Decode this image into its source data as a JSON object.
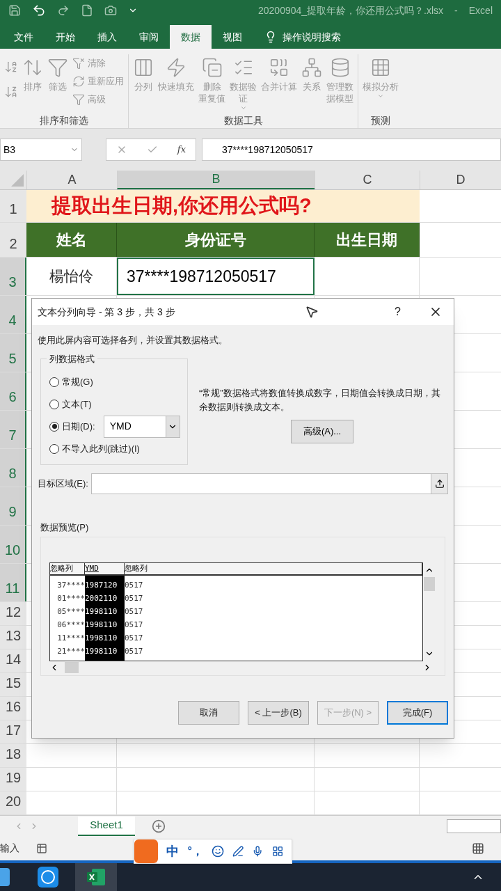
{
  "title_bar": {
    "file_name": "20200904_提取年龄，你还用公式吗？.xlsx",
    "separator": "-",
    "app": "Excel"
  },
  "ribbon_tabs": [
    {
      "label": "文件",
      "selected": false
    },
    {
      "label": "开始",
      "selected": false
    },
    {
      "label": "插入",
      "selected": false
    },
    {
      "label": "审阅",
      "selected": false
    },
    {
      "label": "数据",
      "selected": true
    },
    {
      "label": "视图",
      "selected": false
    }
  ],
  "tell_me": "操作说明搜索",
  "ribbon_groups": [
    {
      "label": "排序和筛选",
      "items": [
        {
          "kind": "icon"
        },
        {
          "kind": "icon"
        },
        {
          "kind": "large",
          "label": "排序"
        },
        {
          "kind": "large",
          "label": "筛选"
        },
        {
          "kind": "small",
          "label": "清除"
        },
        {
          "kind": "small",
          "label": "重新应用"
        },
        {
          "kind": "small",
          "label": "高级"
        }
      ]
    },
    {
      "label": "数据工具",
      "items": [
        {
          "kind": "large",
          "label": "分列",
          "dropdown": false
        },
        {
          "kind": "large",
          "label": "快速填充",
          "dropdown": false
        },
        {
          "kind": "large",
          "lines": [
            "删除",
            "重复值"
          ],
          "dropdown": false
        },
        {
          "kind": "large",
          "lines": [
            "数据验",
            "证"
          ],
          "dropdown": true
        },
        {
          "kind": "large",
          "label": "合并计算",
          "dropdown": false
        },
        {
          "kind": "large",
          "label": "关系",
          "dropdown": false
        },
        {
          "kind": "large",
          "lines": [
            "管理数",
            "据模型"
          ],
          "dropdown": false
        }
      ]
    },
    {
      "label": "预测",
      "items": [
        {
          "kind": "large",
          "label": "模拟分析",
          "dropdown": true
        }
      ]
    }
  ],
  "formula_bar": {
    "name_box": "B3",
    "fx": "fx",
    "value": "37****198712050517"
  },
  "columns": [
    {
      "label": "A",
      "selected": false
    },
    {
      "label": "B",
      "selected": true
    },
    {
      "label": "C",
      "selected": false
    },
    {
      "label": "D",
      "selected": false
    }
  ],
  "rows": [
    {
      "number": "1",
      "selected": false
    },
    {
      "number": "2",
      "selected": false
    },
    {
      "number": "3",
      "selected": true
    },
    {
      "number": "4",
      "selected": true
    },
    {
      "number": "5",
      "selected": true
    },
    {
      "number": "6",
      "selected": true
    },
    {
      "number": "7",
      "selected": true
    },
    {
      "number": "8",
      "selected": true
    },
    {
      "number": "9",
      "selected": true
    },
    {
      "number": "10",
      "selected": true
    },
    {
      "number": "11",
      "selected": true
    },
    {
      "number": "12",
      "selected": false
    },
    {
      "number": "13",
      "selected": false
    },
    {
      "number": "14",
      "selected": false
    },
    {
      "number": "15",
      "selected": false
    },
    {
      "number": "16",
      "selected": false
    },
    {
      "number": "17",
      "selected": false
    },
    {
      "number": "18",
      "selected": false
    },
    {
      "number": "19",
      "selected": false
    },
    {
      "number": "20",
      "selected": false
    }
  ],
  "sheet_title": "提取出生日期,你还用公式吗?",
  "table_headers": [
    "姓名",
    "身份证号",
    "出生日期"
  ],
  "table_row": [
    "楊怡伶",
    "37****198712050517"
  ],
  "dialog": {
    "title": "文本分列向导 - 第 3 步，共 3 步",
    "help": "?",
    "instruction": "使用此屏内容可选择各列，并设置其数据格式。",
    "format_group": "列数据格式",
    "formats": [
      {
        "label": "常规(G)",
        "selected": false
      },
      {
        "label": "文本(T)",
        "selected": false
      },
      {
        "label": "日期(D):",
        "selected": true
      },
      {
        "label": "不导入此列(跳过)(I)",
        "selected": false
      }
    ],
    "date_format": "YMD",
    "description": "“常规”数据格式将数值转换成数字，日期值会转换成日期，其余数据则转换成文本。",
    "advanced_button": "高级(A)...",
    "destination_label": "目标区域(E):",
    "preview_label": "数据预览(P)",
    "preview_columns": [
      {
        "label": "忽略列",
        "selected": false
      },
      {
        "label": "YMD",
        "selected": true
      },
      {
        "label": "忽略列",
        "selected": false
      }
    ],
    "preview_rows": [
      [
        "37****",
        "1987120",
        "0517"
      ],
      [
        "01****",
        "2002110",
        "0517"
      ],
      [
        "05****",
        "1998110",
        "0517"
      ],
      [
        "06****",
        "1998110",
        "0517"
      ],
      [
        "11****",
        "1998110",
        "0517"
      ],
      [
        "21****",
        "1998110",
        "0517"
      ]
    ],
    "buttons": [
      {
        "label": "取消",
        "disabled": false,
        "default": false
      },
      {
        "label": "< 上一步(B)",
        "disabled": false,
        "default": false
      },
      {
        "label": "下一步(N) >",
        "disabled": true,
        "default": false
      },
      {
        "label": "完成(F)",
        "disabled": false,
        "default": true
      }
    ]
  },
  "sheet_tabs": [
    {
      "label": "Sheet1",
      "selected": true
    }
  ],
  "status": "输入",
  "ime_toolbar": {
    "mode": "中",
    "punctuation": "°，"
  }
}
